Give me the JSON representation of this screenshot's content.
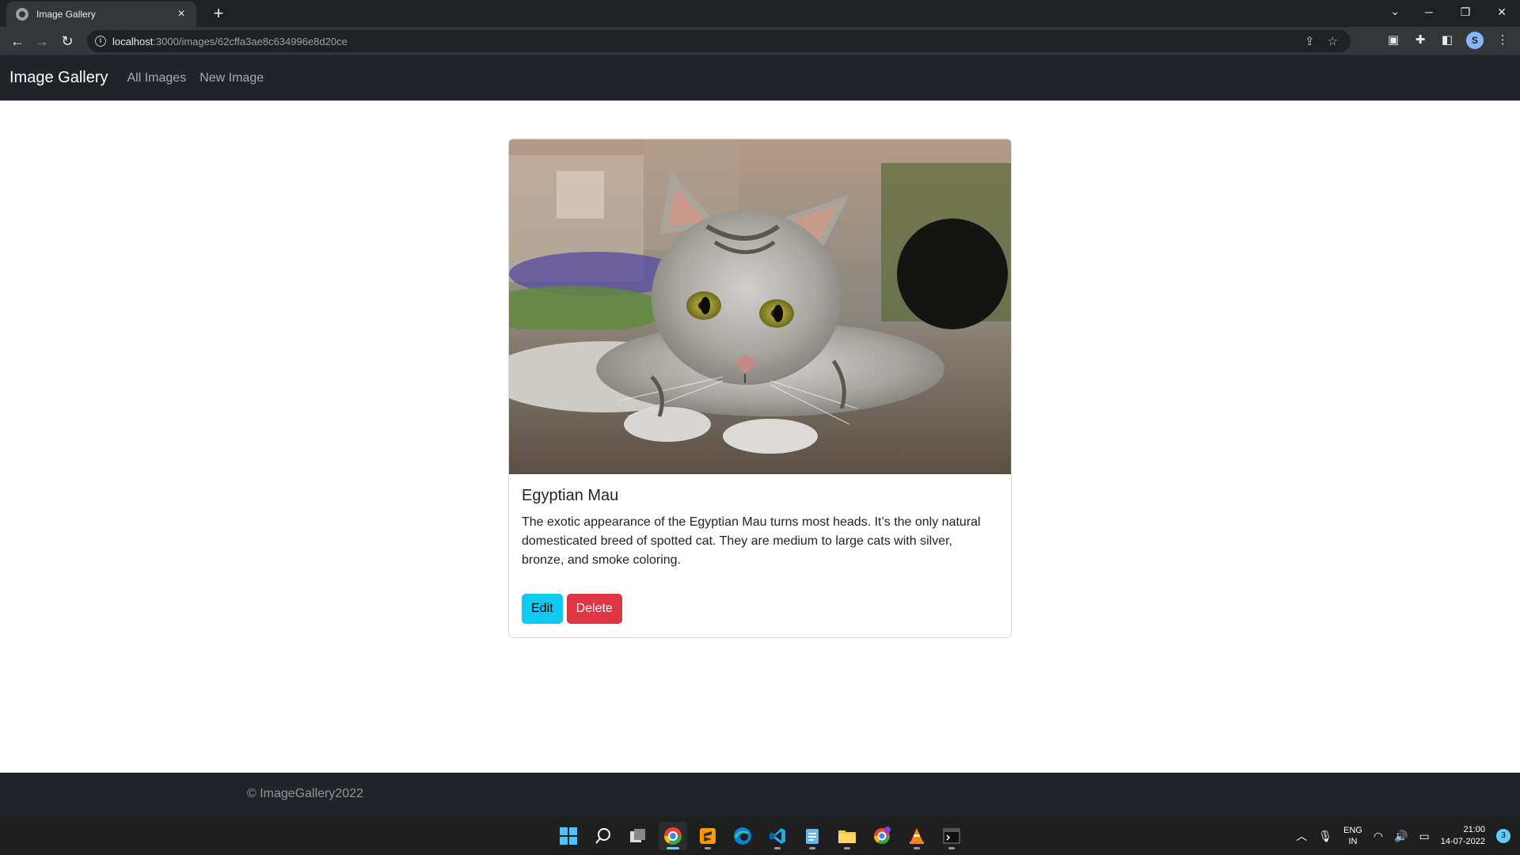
{
  "browser": {
    "tab_title": "Image Gallery",
    "tab_close": "×",
    "new_tab": "+",
    "url_host": "localhost",
    "url_path": ":3000/images/62cffa3ae8c634996e8d20ce",
    "profile_initial": "S"
  },
  "navbar": {
    "brand": "Image Gallery",
    "links": [
      {
        "label": "All Images"
      },
      {
        "label": "New Image"
      }
    ]
  },
  "card": {
    "title": "Egyptian Mau",
    "text": "The exotic appearance of the Egyptian Mau turns most heads. It’s the only natural domesticated breed of spotted cat. They are medium to large cats with silver, bronze, and smoke coloring.",
    "edit_label": "Edit",
    "delete_label": "Delete"
  },
  "footer": {
    "text": "© ImageGallery2022"
  },
  "taskbar": {
    "lang_line1": "ENG",
    "lang_line2": "IN",
    "time": "21:00",
    "date": "14-07-2022",
    "notification_count": "3"
  },
  "colors": {
    "navbar_bg": "#212529",
    "edit_button": "#0dcaf0",
    "delete_button": "#dc3545"
  }
}
